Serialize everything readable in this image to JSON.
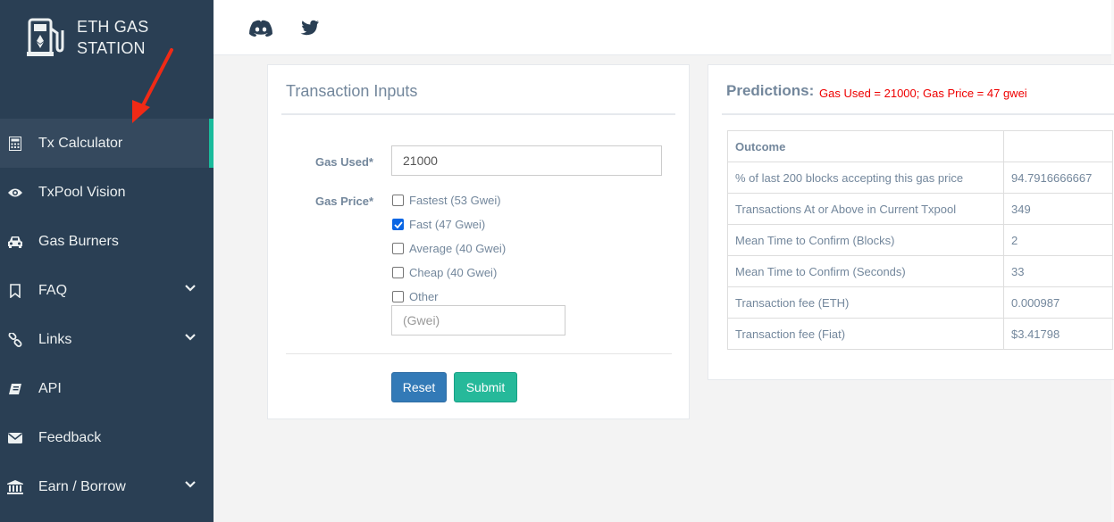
{
  "brand": {
    "line1": "ETH GAS",
    "line2": "STATION",
    "logo_icon": "gas-pump-icon"
  },
  "sidebar": {
    "items": [
      {
        "label": "Tx Calculator",
        "icon": "calculator-icon",
        "active": true,
        "has_chevron": false
      },
      {
        "label": "TxPool Vision",
        "icon": "eye-icon",
        "active": false,
        "has_chevron": false
      },
      {
        "label": "Gas Burners",
        "icon": "car-icon",
        "active": false,
        "has_chevron": false
      },
      {
        "label": "FAQ",
        "icon": "bookmark-icon",
        "active": false,
        "has_chevron": true
      },
      {
        "label": "Links",
        "icon": "link-icon",
        "active": false,
        "has_chevron": true
      },
      {
        "label": "API",
        "icon": "book-icon",
        "active": false,
        "has_chevron": false
      },
      {
        "label": "Feedback",
        "icon": "envelope-icon",
        "active": false,
        "has_chevron": false
      },
      {
        "label": "Earn / Borrow",
        "icon": "bank-icon",
        "active": false,
        "has_chevron": true
      }
    ]
  },
  "topbar": {
    "icons": [
      "discord-icon",
      "twitter-icon"
    ]
  },
  "inputs": {
    "title": "Transaction Inputs",
    "gas_used_label": "Gas Used*",
    "gas_used_value": "21000",
    "gas_price_label": "Gas Price*",
    "options": [
      {
        "label": "Fastest (53 Gwei)",
        "checked": false
      },
      {
        "label": "Fast (47 Gwei)",
        "checked": true
      },
      {
        "label": "Average (40 Gwei)",
        "checked": false
      },
      {
        "label": "Cheap (40 Gwei)",
        "checked": false
      },
      {
        "label": "Other",
        "checked": false
      }
    ],
    "other_placeholder": "(Gwei)",
    "reset_label": "Reset",
    "submit_label": "Submit"
  },
  "predictions": {
    "title": "Predictions:",
    "subtitle": "Gas Used = 21000; Gas Price = 47 gwei",
    "header": [
      "Outcome",
      ""
    ],
    "rows": [
      [
        "% of last 200 blocks accepting this gas price",
        "94.7916666667"
      ],
      [
        "Transactions At or Above in Current Txpool",
        "349"
      ],
      [
        "Mean Time to Confirm (Blocks)",
        "2"
      ],
      [
        "Mean Time to Confirm (Seconds)",
        "33"
      ],
      [
        "Transaction fee (ETH)",
        "0.000987"
      ],
      [
        "Transaction fee (Fiat)",
        "$3.41798"
      ]
    ]
  },
  "colors": {
    "sidebar_bg": "#2a3f54",
    "sidebar_active_bg": "#35495e",
    "active_accent": "#1abb9c",
    "primary": "#337ab7",
    "success": "#26b99a",
    "alert": "#ee0000"
  }
}
